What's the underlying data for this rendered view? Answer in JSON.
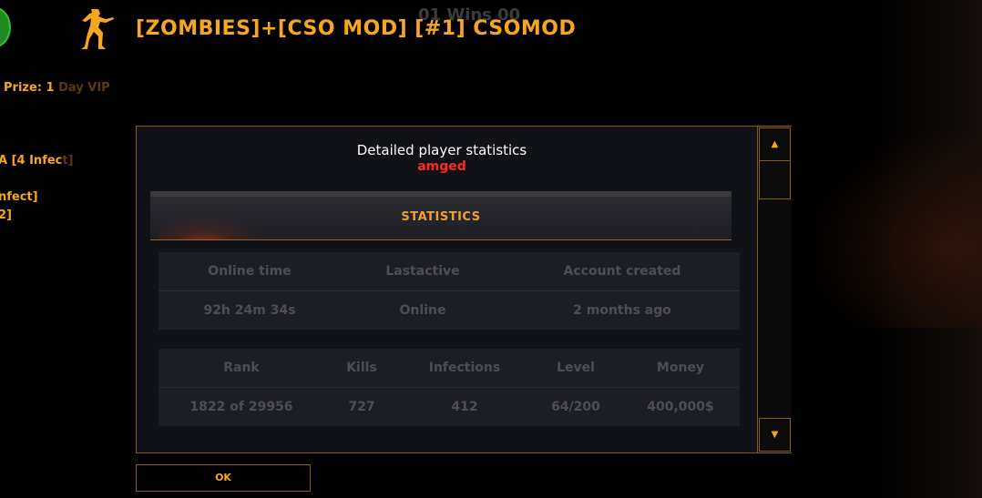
{
  "server": {
    "title": "[ZOMBIES]+[CSO MOD] [#1] CSOMOD",
    "wins_overlay": "01 Wins 00"
  },
  "hud": {
    "prize_label": "Prize: 1",
    "prize_suffix": "Day VIP",
    "line1_main": "A [4 Infec",
    "line1_dim": "t]",
    "line2": "nfect]",
    "line3": "2]"
  },
  "dialog": {
    "title": "Detailed player statistics",
    "player_name": "amged",
    "section_label": "STATISTICS",
    "table1": {
      "headers": [
        "Online time",
        "Lastactive",
        "Account created"
      ],
      "values": [
        "92h 24m 34s",
        "Online",
        "2 months ago"
      ]
    },
    "table2": {
      "headers": [
        "Rank",
        "Kills",
        "Infections",
        "Level",
        "Money"
      ],
      "values": [
        "1822 of 29956",
        "727",
        "412",
        "64/200",
        "400,000$"
      ]
    },
    "scroll_up_icon": "▲",
    "scroll_down_icon": "▼"
  },
  "ok_button": {
    "label": "OK"
  },
  "colors": {
    "accent": "#f7a621",
    "player_name": "#ff2a1a",
    "border": "#8a5a1a"
  }
}
